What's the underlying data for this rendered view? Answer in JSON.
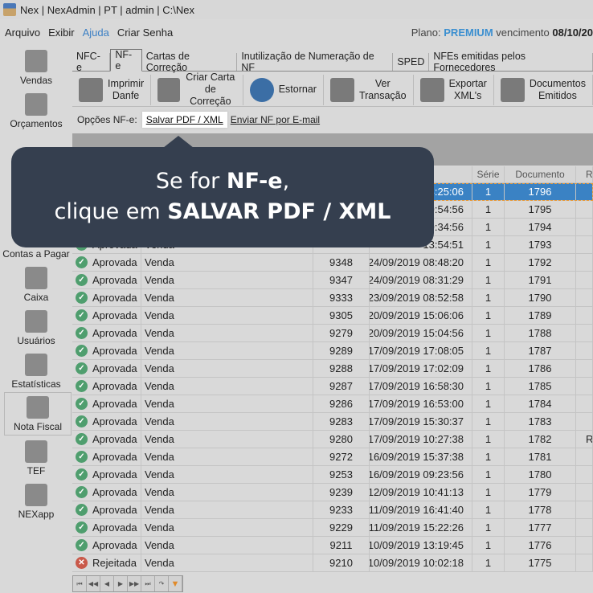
{
  "window": {
    "title": "Nex | NexAdmin | PT | admin | C:\\Nex"
  },
  "menu": [
    "Arquivo",
    "Exibir",
    "Ajuda",
    "Criar Senha"
  ],
  "plan": {
    "label": "Plano:",
    "name": "PREMIUM",
    "expiry_label": "vencimento",
    "expiry": "08/10/20"
  },
  "sidebar": [
    {
      "label": "Vendas",
      "icon": "cart-icon"
    },
    {
      "label": "Orçamentos",
      "icon": "document-icon"
    },
    {
      "label": "",
      "icon": "contact-icon"
    },
    {
      "label": "",
      "icon": ""
    },
    {
      "label": "Contas a Pagar",
      "icon": "bill-icon"
    },
    {
      "label": "Caixa",
      "icon": "cash-register-icon"
    },
    {
      "label": "Usuários",
      "icon": "user-icon"
    },
    {
      "label": "Estatísticas",
      "icon": "chart-icon"
    },
    {
      "label": "Nota Fiscal",
      "icon": "qr-code-icon"
    },
    {
      "label": "TEF",
      "icon": "card-terminal-icon"
    },
    {
      "label": "NEXapp",
      "icon": "phone-icon"
    }
  ],
  "tabs": [
    "NFC-e",
    "NF-e",
    "Cartas de Correção",
    "Inutilização de Numeração de NF",
    "SPED",
    "NFEs emitidas pelos Fornecedores"
  ],
  "toolbar": [
    {
      "l1": "Imprimir",
      "l2": "Danfe",
      "icon": "printer-icon"
    },
    {
      "l1": "Criar Carta",
      "l2": "de Correção",
      "icon": "add-document-icon"
    },
    {
      "l1": "Estornar",
      "l2": "",
      "icon": "undo-icon"
    },
    {
      "l1": "Ver",
      "l2": "Transação",
      "icon": "search-document-icon"
    },
    {
      "l1": "Exportar",
      "l2": "XML's",
      "icon": "export-icon"
    },
    {
      "l1": "Documentos",
      "l2": "Emitidos",
      "icon": "money-document-icon"
    }
  ],
  "options": {
    "label": "Opções NF-e:",
    "save": "Salvar PDF / XML",
    "email": "Enviar NF por E-mail"
  },
  "columns": [
    "",
    "",
    "",
    "",
    "Série",
    "Documento",
    "RS"
  ],
  "rows": [
    [
      "",
      "",
      "",
      "3:25:06",
      "1",
      "1796",
      ""
    ],
    [
      "",
      "",
      "",
      "9:54:56",
      "1",
      "1795",
      ""
    ],
    [
      "",
      "",
      "",
      "9:34:56",
      "1",
      "1794",
      ""
    ],
    [
      "Aprovada",
      "Venda",
      "",
      "13:54:51",
      "1",
      "1793",
      ""
    ],
    [
      "Aprovada",
      "Venda",
      "9348",
      "24/09/2019 08:48:20",
      "1",
      "1792",
      ""
    ],
    [
      "Aprovada",
      "Venda",
      "9347",
      "24/09/2019 08:31:29",
      "1",
      "1791",
      ""
    ],
    [
      "Aprovada",
      "Venda",
      "9333",
      "23/09/2019 08:52:58",
      "1",
      "1790",
      ""
    ],
    [
      "Aprovada",
      "Venda",
      "9305",
      "20/09/2019 15:06:06",
      "1",
      "1789",
      ""
    ],
    [
      "Aprovada",
      "Venda",
      "9279",
      "20/09/2019 15:04:56",
      "1",
      "1788",
      ""
    ],
    [
      "Aprovada",
      "Venda",
      "9289",
      "17/09/2019 17:08:05",
      "1",
      "1787",
      ""
    ],
    [
      "Aprovada",
      "Venda",
      "9288",
      "17/09/2019 17:02:09",
      "1",
      "1786",
      ""
    ],
    [
      "Aprovada",
      "Venda",
      "9287",
      "17/09/2019 16:58:30",
      "1",
      "1785",
      ""
    ],
    [
      "Aprovada",
      "Venda",
      "9286",
      "17/09/2019 16:53:00",
      "1",
      "1784",
      ""
    ],
    [
      "Aprovada",
      "Venda",
      "9283",
      "17/09/2019 15:30:37",
      "1",
      "1783",
      ""
    ],
    [
      "Aprovada",
      "Venda",
      "9280",
      "17/09/2019 10:27:38",
      "1",
      "1782",
      "R"
    ],
    [
      "Aprovada",
      "Venda",
      "9272",
      "16/09/2019 15:37:38",
      "1",
      "1781",
      ""
    ],
    [
      "Aprovada",
      "Venda",
      "9253",
      "16/09/2019 09:23:56",
      "1",
      "1780",
      ""
    ],
    [
      "Aprovada",
      "Venda",
      "9239",
      "12/09/2019 10:41:13",
      "1",
      "1779",
      ""
    ],
    [
      "Aprovada",
      "Venda",
      "9233",
      "11/09/2019 16:41:40",
      "1",
      "1778",
      ""
    ],
    [
      "Aprovada",
      "Venda",
      "9229",
      "11/09/2019 15:22:26",
      "1",
      "1777",
      ""
    ],
    [
      "Aprovada",
      "Venda",
      "9211",
      "10/09/2019 13:19:45",
      "1",
      "1776",
      ""
    ],
    [
      "Rejeitada",
      "Venda",
      "9210",
      "10/09/2019 10:02:18",
      "1",
      "1775",
      ""
    ]
  ],
  "callout": {
    "line1_pre": "Se for ",
    "line1_bold": "NF-e",
    "line1_post": ",",
    "line2_pre": "clique em ",
    "line2_bold": "SALVAR PDF / XML"
  },
  "colors": {
    "callout_bg": "#353f4f",
    "selected_row": "#3a82c4",
    "approved": "#4f9e6e",
    "rejected": "#c9594a",
    "premium": "#3b8fd0"
  }
}
